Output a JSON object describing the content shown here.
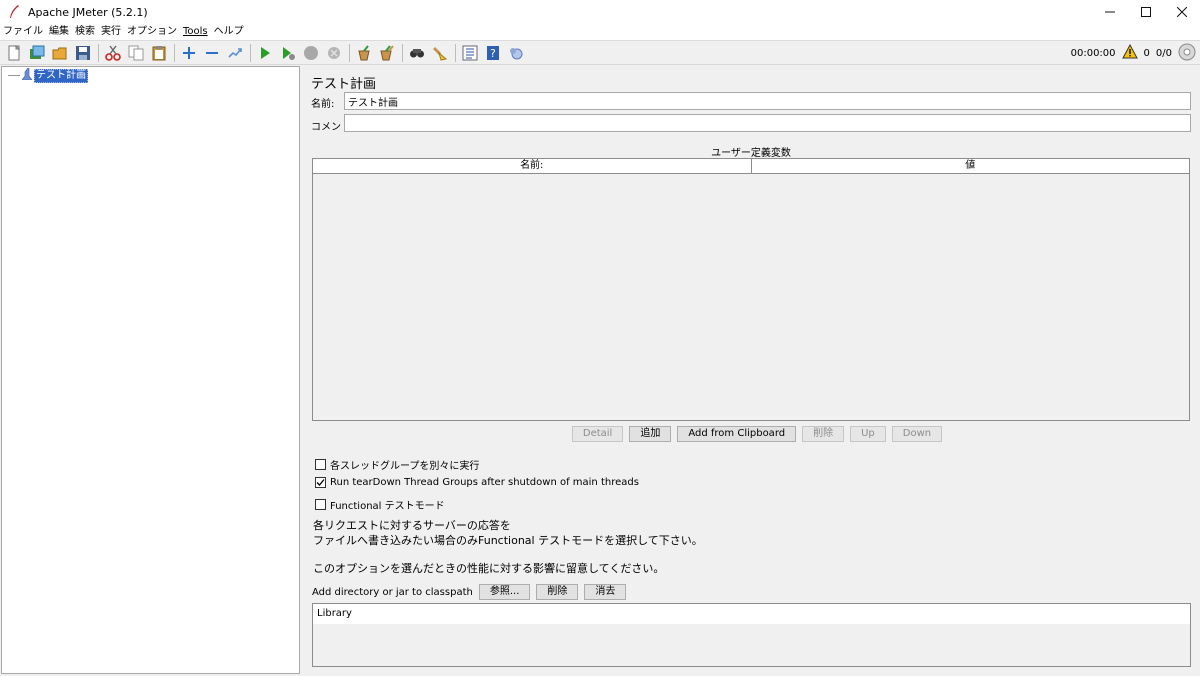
{
  "window": {
    "title": "Apache JMeter (5.2.1)"
  },
  "menu": [
    "ファイル",
    "編集",
    "検索",
    "実行",
    "オプション",
    "Tools",
    "ヘルプ"
  ],
  "toolbar": {
    "buttons": [
      "new-icon",
      "templates-icon",
      "open-icon",
      "save-icon",
      "cut-icon",
      "copy-icon",
      "paste-icon",
      "expand-icon",
      "collapse-icon",
      "toggle-icon",
      "start-icon",
      "start-no-pause-icon",
      "stop-icon",
      "shutdown-icon",
      "clear-icon",
      "clear-all-icon",
      "search-icon",
      "reset-search-icon",
      "function-helper-icon",
      "help-icon",
      "remote-icon"
    ],
    "timer": "00:00:00",
    "warning_count": "0",
    "threads": "0/0"
  },
  "tree": {
    "root_label": "テスト計画"
  },
  "panel": {
    "title": "テスト計画",
    "name_label": "名前:",
    "name_value": "テスト計画",
    "comment_label": "コメント:",
    "comment_value": ""
  },
  "variables_table": {
    "title": "ユーザー定義変数",
    "columns": [
      "名前:",
      "値"
    ],
    "rows": []
  },
  "table_buttons": [
    {
      "label": "Detail",
      "enabled": false
    },
    {
      "label": "追加",
      "enabled": true
    },
    {
      "label": "Add from Clipboard",
      "enabled": true
    },
    {
      "label": "削除",
      "enabled": false
    },
    {
      "label": "Up",
      "enabled": false
    },
    {
      "label": "Down",
      "enabled": false
    }
  ],
  "options": {
    "serialize": {
      "label": "各スレッドグループを別々に実行",
      "checked": false
    },
    "teardown": {
      "label": "Run tearDown Thread Groups after shutdown of main threads",
      "checked": true
    },
    "functional": {
      "label": "Functional テストモード",
      "checked": false
    }
  },
  "notes": {
    "line1": "各リクエストに対するサーバーの応答を",
    "line2": "ファイルへ書き込みたい場合のみFunctional テストモードを選択して下さい。",
    "line3": "このオプションを選んだときの性能に対する影響に留意してください。"
  },
  "classpath": {
    "label": "Add directory or jar to classpath",
    "browse": "参照...",
    "delete": "削除",
    "clear": "消去",
    "library_header": "Library"
  },
  "colors": {
    "selection": "#2f66c6",
    "start_green": "#2a9d2a"
  }
}
